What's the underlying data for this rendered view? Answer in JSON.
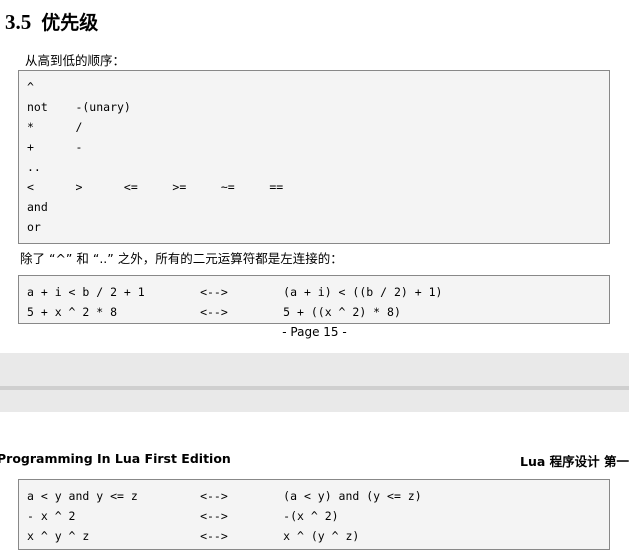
{
  "document": {
    "section": {
      "number": "3.5",
      "title": "优先级"
    },
    "paragraphs": {
      "intro": "从高到低的顺序：",
      "assoc_note": "除了 “^” 和 “..” 之外，所有的二元运算符都是左连接的："
    },
    "code_precedence": {
      "lines": [
        "^",
        "not    -(unary)",
        "*      /",
        "+      -",
        "..",
        "<      >      <=     >=     ~=     ==",
        "and",
        "or"
      ]
    },
    "code_assoc": {
      "lines": [
        "a + i < b / 2 + 1        <-->        (a + i) < ((b / 2) + 1)",
        "5 + x ^ 2 * 8            <-->        5 + ((x ^ 2) * 8)"
      ]
    },
    "page_footer": "- Page 15 -",
    "running_header": {
      "left": "Programming In Lua First Edition",
      "right": "Lua 程序设计  第一"
    },
    "code_assoc_next": {
      "lines": [
        "a < y and y <= z         <-->        (a < y) and (y <= z)",
        "- x ^ 2                  <-->        -(x ^ 2)",
        "x ^ y ^ z                <-->        x ^ (y ^ z)"
      ]
    }
  }
}
